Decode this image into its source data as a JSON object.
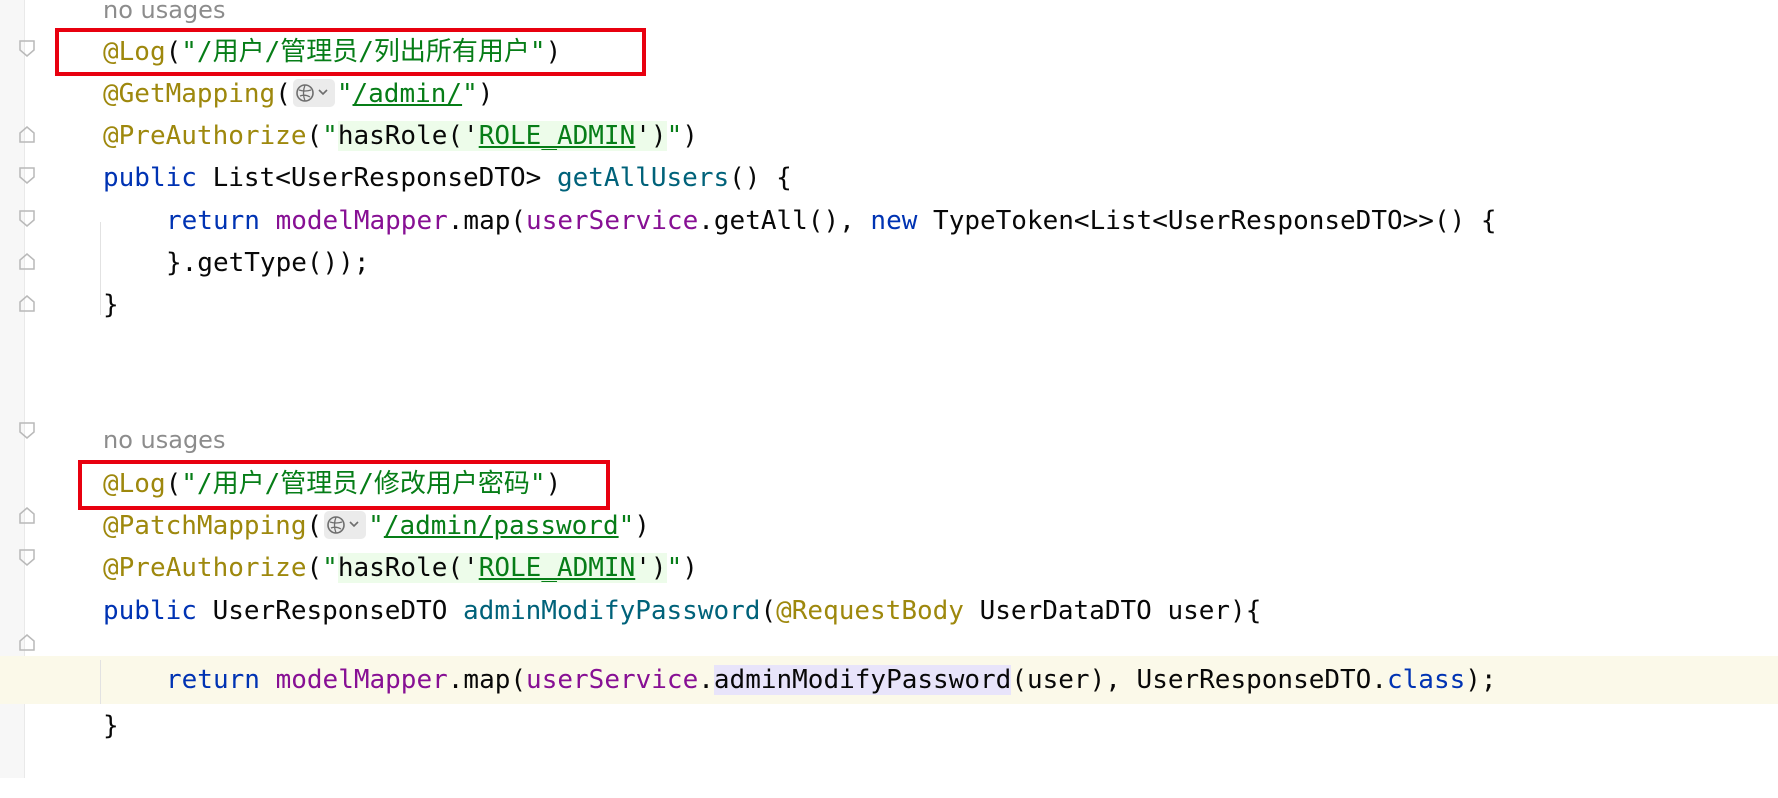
{
  "editor": {
    "hint_no_usages": "no usages",
    "method1": {
      "log_annotation": "@Log",
      "log_value": "\"/用户/管理员/列出所有用户\"",
      "mapping_annotation": "@GetMapping",
      "mapping_path": "/admin/",
      "preauth_annotation": "@PreAuthorize",
      "preauth_spel": "hasRole('",
      "preauth_role": "ROLE_ADMIN",
      "preauth_end": "')",
      "sig_public": "public",
      "sig_return_type": " List<UserResponseDTO> ",
      "sig_name": "getAllUsers",
      "sig_rest": "() {",
      "body_return": "return",
      "body_mapper": "modelMapper",
      "body_map": ".map(",
      "body_service": "userService",
      "body_call": ".getAll(), ",
      "body_new": "new",
      "body_typetoken": " TypeToken<List<UserResponseDTO>>() {",
      "body_gettype": "}.getType());",
      "close_brace": "}"
    },
    "method2": {
      "log_annotation": "@Log",
      "log_value": "\"/用户/管理员/修改用户密码\"",
      "mapping_annotation": "@PatchMapping",
      "mapping_path": "/admin/password",
      "preauth_annotation": "@PreAuthorize",
      "preauth_spel": "hasRole('",
      "preauth_role": "ROLE_ADMIN",
      "preauth_end": "')",
      "sig_public": "public",
      "sig_return_type": " UserResponseDTO ",
      "sig_name": "adminModifyPassword",
      "sig_param_ann": "@RequestBody",
      "sig_rest": " UserDataDTO user){",
      "body_return": "return",
      "body_mapper": "modelMapper",
      "body_map": ".map(",
      "body_service": "userService",
      "body_dot": ".",
      "body_method": "adminModifyPassword",
      "body_args": "(user), UserResponseDTO.",
      "body_class": "class",
      "body_end": ");",
      "close_brace": "}"
    },
    "colors": {
      "annotation": "#9e880d",
      "string": "#067d17",
      "keyword": "#0033b3",
      "method_decl": "#00627a",
      "field": "#871094",
      "highlight_box": "#e8000f"
    }
  }
}
